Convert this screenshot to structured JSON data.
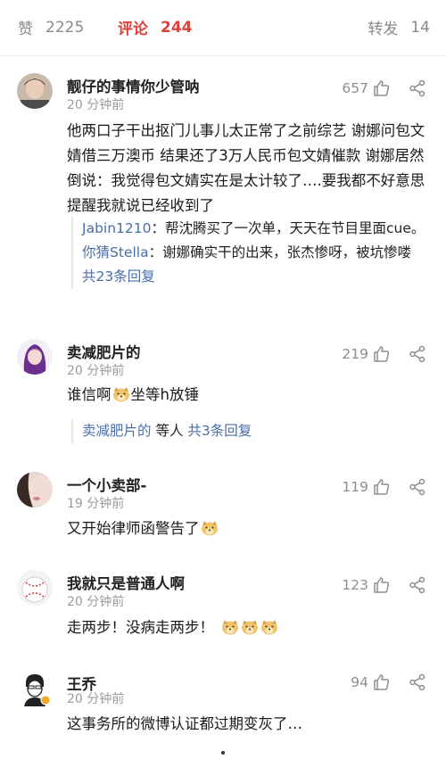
{
  "stats": {
    "likes_label": "赞",
    "likes_count": "2225",
    "comments_label": "评论",
    "comments_count": "244",
    "reposts_label": "转发",
    "reposts_count": "14"
  },
  "comments": [
    {
      "username": "靓仔的事情你少管呐",
      "time": "20 分钟前",
      "likes": "657",
      "text": "他两口子干出抠门儿事儿太正常了之前综艺 谢娜问包文婧借三万澳币 结果还了3万人民币包文婧催款 谢娜居然倒说：我觉得包文婧实在是太计较了….要我都不好意思提醒我就说已经收到了",
      "replies": [
        {
          "name": "Jabin1210",
          "sep": "：",
          "text": "帮沈腾买了一次单，天天在节目里面cue。"
        },
        {
          "name": "你猜Stella",
          "sep": "：",
          "text": "谢娜确实干的出来，张杰惨呀，被坑惨喽"
        }
      ],
      "more": "共23条回复"
    },
    {
      "username": "卖减肥片的",
      "time": "20 分钟前",
      "likes": "219",
      "text_a": "谁信啊",
      "text_b": "坐等h放锤",
      "reply_name": "卖减肥片的",
      "reply_mid": " 等人 ",
      "more": "共3条回复"
    },
    {
      "username": "一个小卖部-",
      "time": "19 分钟前",
      "likes": "119",
      "text": "又开始律师函警告了"
    },
    {
      "username": "我就只是普通人啊",
      "time": "20 分钟前",
      "likes": "123",
      "text": "走两步！没病走两步！"
    },
    {
      "username": "王乔",
      "time": "20 分钟前",
      "likes": "94",
      "text": "这事务所的微博认证都过期变灰了…"
    }
  ],
  "icons": {
    "like": "thumbs-up-icon",
    "share": "share-icon",
    "emoji": "doge-emoji-icon"
  },
  "colors": {
    "accent_red": "#e0403a",
    "link_blue": "#4a6ea8",
    "muted_gray": "#8a8a8a"
  }
}
